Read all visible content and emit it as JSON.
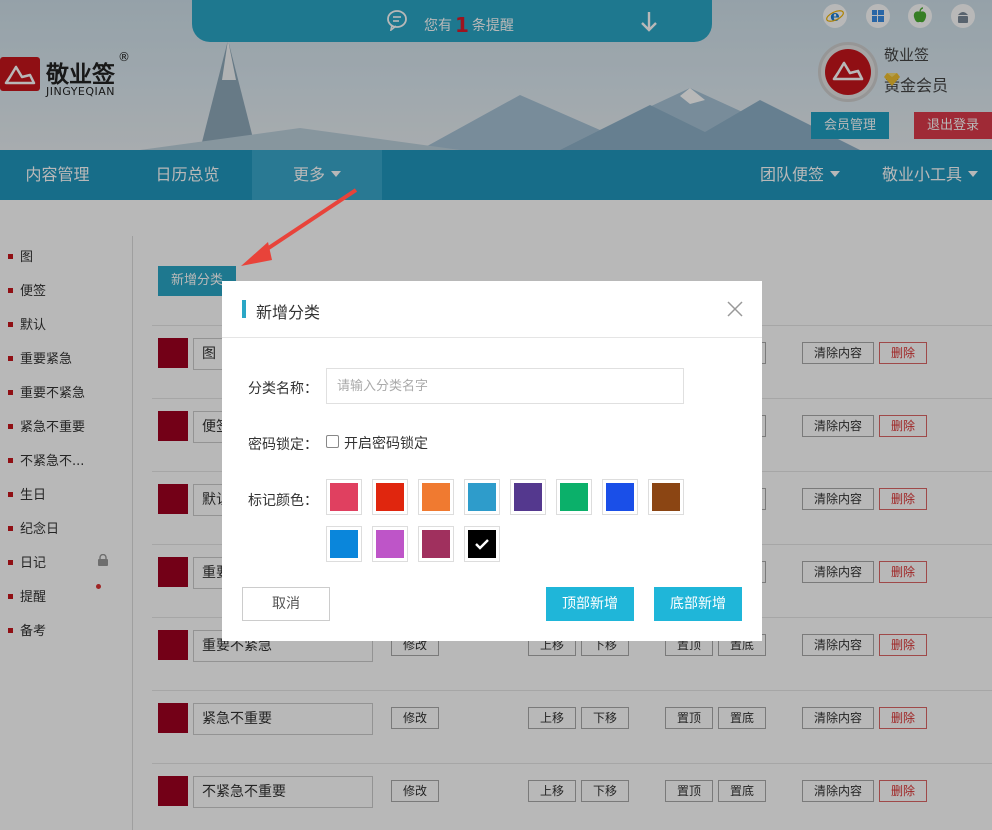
{
  "header": {
    "notice_prefix": "您有",
    "notice_count": "1",
    "notice_suffix": "条提醒",
    "logo_cn": "敬业签",
    "logo_en": "JINGYEQIAN",
    "logo_reg": "®",
    "platform_icons": [
      "ie-icon",
      "windows-icon",
      "apple-icon",
      "android-icon"
    ],
    "username": "敬业签",
    "member_level": "黄金会员",
    "member_btn": "会员管理",
    "logout_btn": "退出登录"
  },
  "nav": {
    "content": "内容管理",
    "calendar": "日历总览",
    "more": "更多",
    "team": "团队便签",
    "tools": "敬业小工具"
  },
  "sidebar": {
    "items": [
      "图",
      "便签",
      "默认",
      "重要紧急",
      "重要不紧急",
      "紧急不重要",
      "不紧急不...",
      "生日",
      "纪念日",
      "日记",
      "提醒",
      "备考"
    ]
  },
  "main": {
    "add_category_btn": "新增分类",
    "row_buttons": {
      "edit": "修改",
      "up": "上移",
      "down": "下移",
      "top": "置顶",
      "bottom": "置底",
      "clear": "清除内容",
      "delete": "删除"
    },
    "rows": [
      {
        "name": "图"
      },
      {
        "name": "便签"
      },
      {
        "name": "默认"
      },
      {
        "name": "重要"
      },
      {
        "name": "重要不紧急"
      },
      {
        "name": "紧急不重要"
      },
      {
        "name": "不紧急不重要"
      }
    ]
  },
  "dialog": {
    "title": "新增分类",
    "name_label": "分类名称：",
    "name_placeholder": "请输入分类名字",
    "name_value": "",
    "lock_label": "密码锁定：",
    "lock_checkbox_label": "开启密码锁定",
    "lock_checked": false,
    "color_label": "标记颜色：",
    "colors": [
      "#e04060",
      "#e0260e",
      "#f07a30",
      "#2e9ccb",
      "#54388e",
      "#0bb06a",
      "#1a4fe8",
      "#8b4513",
      "#0a86db",
      "#be55c8",
      "#a0305e",
      "#000000"
    ],
    "selected_color": "#000000",
    "cancel_btn": "取消",
    "top_add_btn": "顶部新增",
    "bottom_add_btn": "底部新增"
  }
}
